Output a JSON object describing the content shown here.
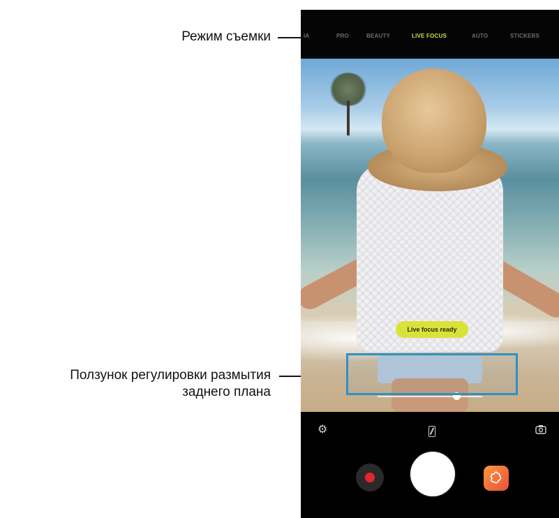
{
  "callouts": {
    "shooting_mode": "Режим съемки",
    "blur_slider_line1": "Ползунок регулировки размытия",
    "blur_slider_line2": "заднего плана"
  },
  "camera": {
    "modes": [
      {
        "label": "IA",
        "active": false
      },
      {
        "label": "PRO",
        "active": false
      },
      {
        "label": "BEAUTY",
        "active": false
      },
      {
        "label": "LIVE FOCUS",
        "active": true
      },
      {
        "label": "AUTO",
        "active": false
      },
      {
        "label": "STICKERS",
        "active": false
      }
    ],
    "status_pill": "Live focus ready",
    "blur_level": 0.75,
    "icons": {
      "settings": "gear-icon",
      "aspect_ratio": "aspect-ratio-icon",
      "switch_camera": "switch-camera-icon",
      "record": "record-icon",
      "effects": "effects-icon"
    },
    "colors": {
      "active_mode": "#c8e04a",
      "pill": "#d8e23a",
      "record": "#e3262c",
      "highlight": "#2f8fc6",
      "effects": "#f06a3c"
    }
  }
}
